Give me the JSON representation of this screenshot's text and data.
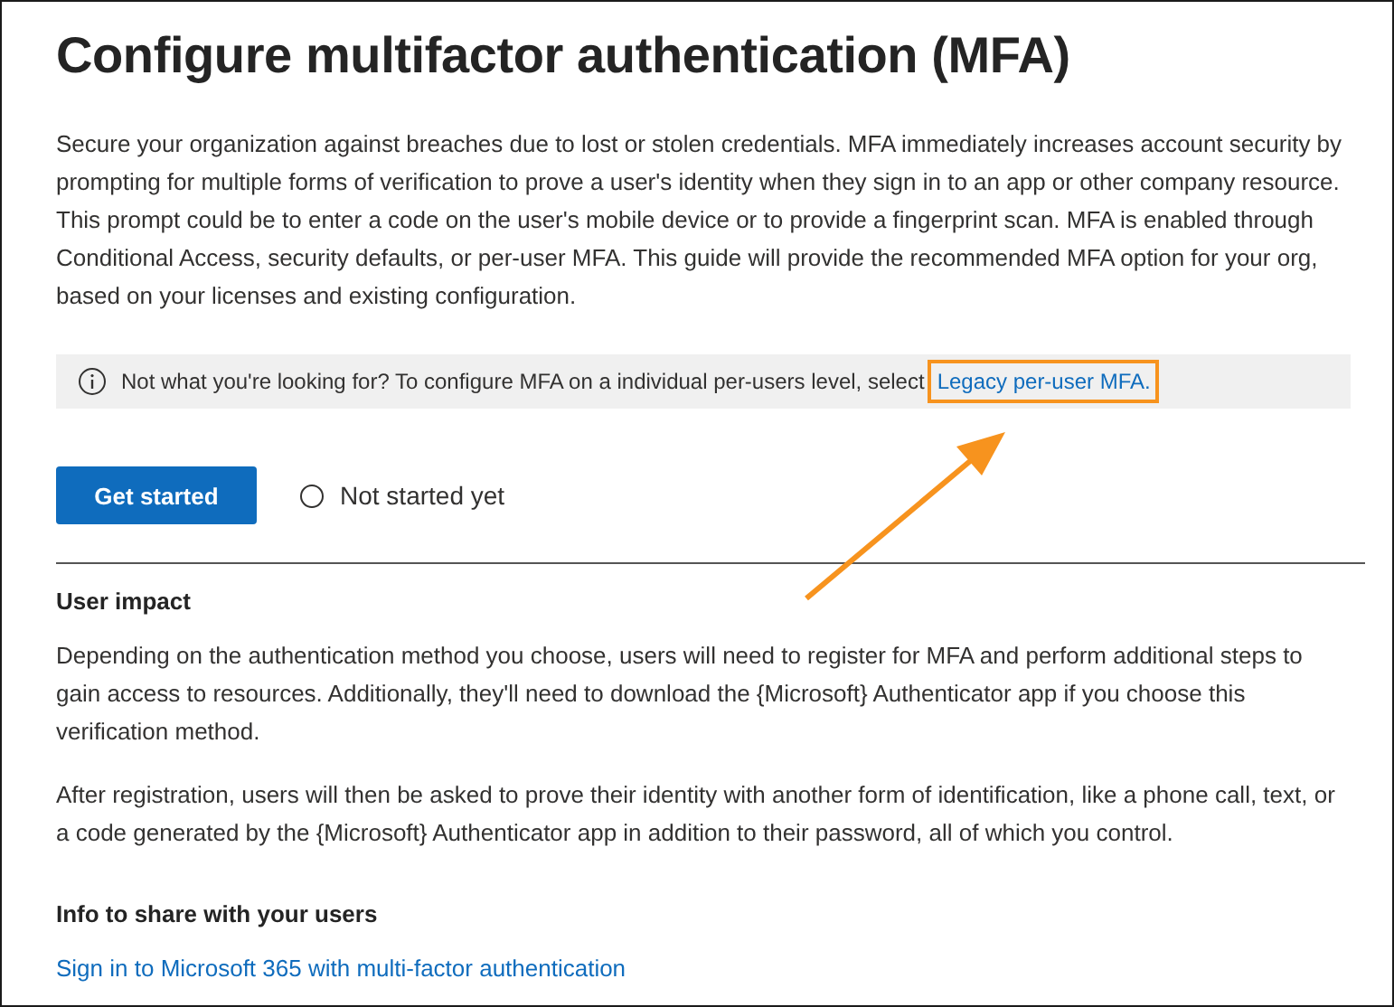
{
  "title": "Configure multifactor authentication (MFA)",
  "intro": "Secure your organization against breaches due to lost or stolen credentials. MFA immediately increases account security by prompting for multiple forms of verification to prove a user's identity when they sign in to an app or other company resource. This prompt could be to enter a code on the user's mobile device or to provide a fingerprint scan. MFA is enabled through Conditional Access, security defaults, or per-user MFA. This guide will provide the recommended MFA option for your org, based on your licenses and existing configuration.",
  "info_bar": {
    "text": "Not what you're looking for? To configure MFA on a individual per-users level, select",
    "link": "Legacy per-user MFA.",
    "highlighted": true
  },
  "primary_button": "Get started",
  "status": {
    "label": "Not started yet",
    "selected": false
  },
  "sections": [
    {
      "heading": "User impact",
      "paragraphs": [
        "Depending on the authentication method you choose, users will need to register for MFA and perform additional steps to gain access to resources. Additionally, they'll need to download the {Microsoft} Authenticator app if you choose this verification method.",
        "After registration, users will then be asked to prove their identity with another form of identification, like a phone call, text, or a code generated by the {Microsoft} Authenticator app in addition to their password, all of which you control."
      ]
    },
    {
      "heading": "Info to share with your users",
      "links": [
        "Sign in to Microsoft 365 with multi-factor authentication"
      ]
    }
  ]
}
